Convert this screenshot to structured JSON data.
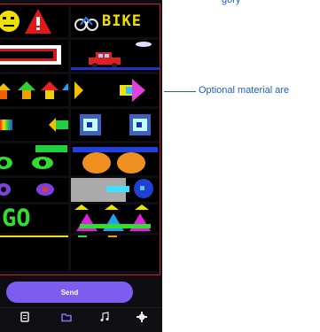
{
  "tiles": {
    "bike_text": "BIKE",
    "go_text": "GO"
  },
  "send_button": {
    "label": "Send"
  },
  "bottom_nav": {
    "items": [
      {
        "name": "tab-text",
        "icon": "file-icon"
      },
      {
        "name": "tab-material",
        "icon": "folder-icon",
        "active": true
      },
      {
        "name": "tab-music",
        "icon": "music-note-icon"
      },
      {
        "name": "tab-settings",
        "icon": "gear-icon"
      }
    ]
  },
  "annotations": {
    "optional_material": "Optional material are",
    "top_partial": "gory"
  },
  "colors": {
    "accent": "#7d5cf0",
    "annotation": "#1a5fd6",
    "frame": "#c4202a"
  }
}
